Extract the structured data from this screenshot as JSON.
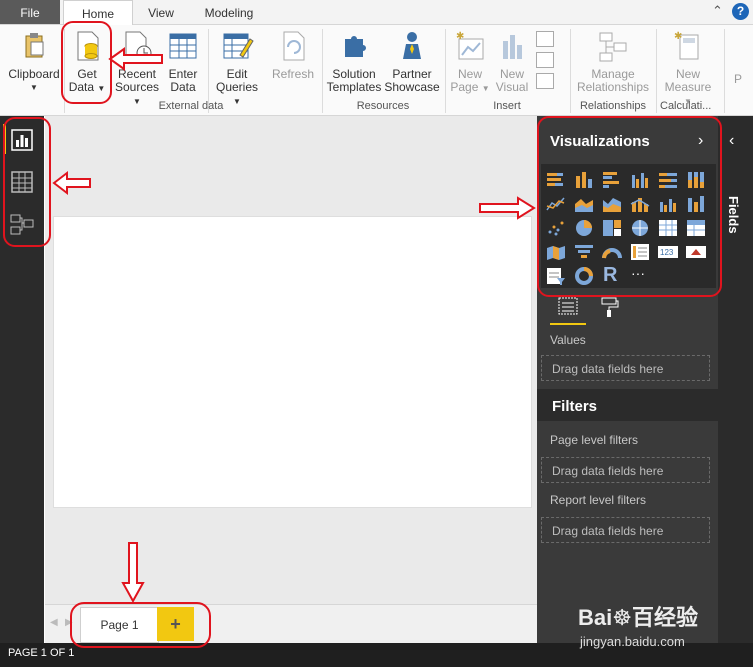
{
  "tabs": {
    "file": "File",
    "home": "Home",
    "view": "View",
    "modeling": "Modeling"
  },
  "ribbon": {
    "clipboard": "Clipboard",
    "get_data_1": "Get",
    "get_data_2": "Data",
    "recent_1": "Recent",
    "recent_2": "Sources",
    "enter_1": "Enter",
    "enter_2": "Data",
    "edit_1": "Edit",
    "edit_2": "Queries",
    "refresh": "Refresh",
    "solution_1": "Solution",
    "solution_2": "Templates",
    "partner_1": "Partner",
    "partner_2": "Showcase",
    "new_page_1": "New",
    "new_page_2": "Page",
    "new_visual_1": "New",
    "new_visual_2": "Visual",
    "manage_1": "Manage",
    "manage_2": "Relationships",
    "new_measure_1": "New",
    "new_measure_2": "Measure",
    "cut_p": "P",
    "group_external": "External data",
    "group_resources": "Resources",
    "group_insert": "Insert",
    "group_relationships": "Relationships",
    "group_calc": "Calculati..."
  },
  "visualizations": {
    "title": "Visualizations",
    "more": "···",
    "r_label": "R",
    "values_label": "Values",
    "drag_fields": "Drag data fields here",
    "filters_title": "Filters",
    "page_filters": "Page level filters",
    "report_filters": "Report level filters"
  },
  "fields_pane": {
    "label": "Fields"
  },
  "pages": {
    "page1": "Page 1",
    "add": "+"
  },
  "status": {
    "text": "PAGE 1 OF 1"
  },
  "watermark": {
    "brand": "Bai☸百经验",
    "url": "jingyan.baidu.com"
  },
  "colors": {
    "accent_yellow": "#f2c811",
    "annotation_red": "#e0141e",
    "pane_dark": "#3a3a3a"
  }
}
